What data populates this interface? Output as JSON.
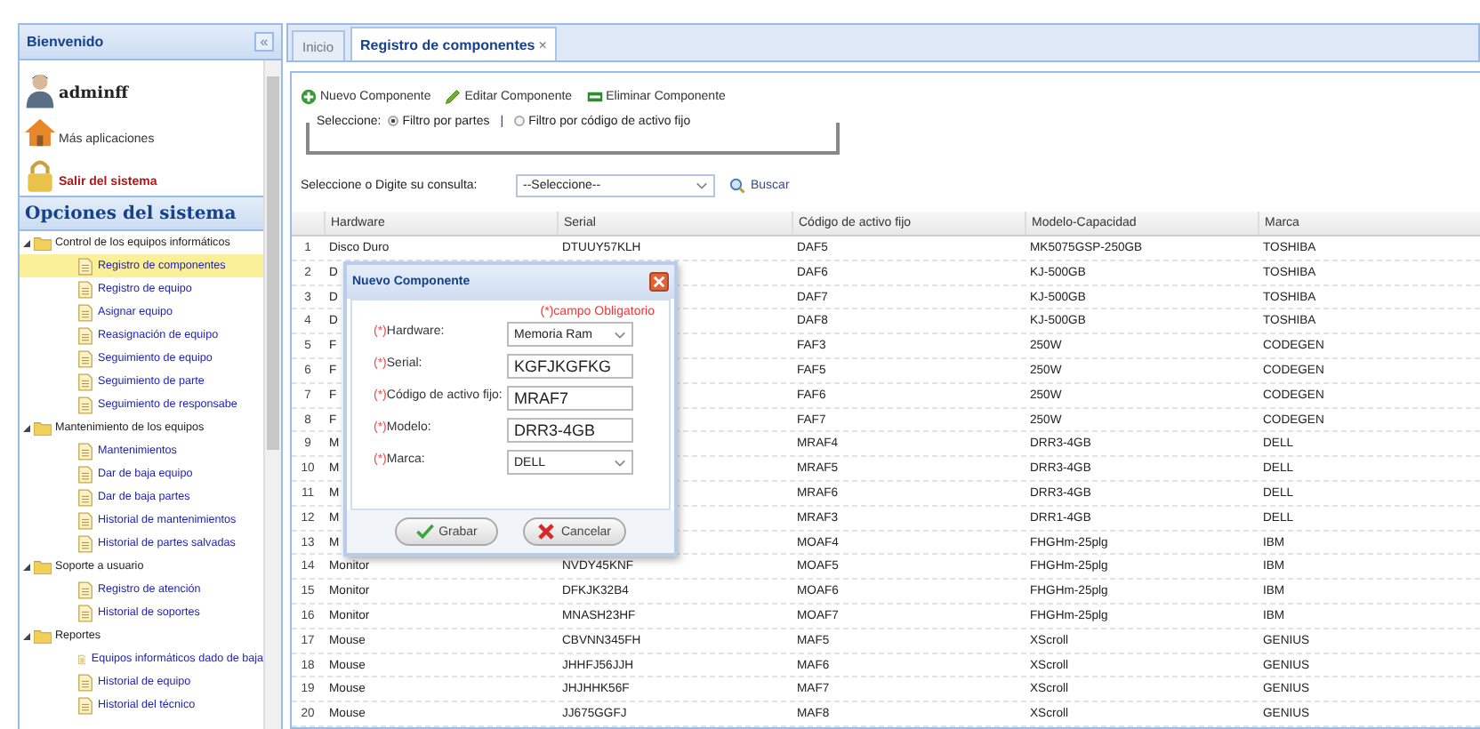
{
  "sidebar": {
    "title": "Bienvenido",
    "collapse": "«",
    "user": "adminff",
    "links": [
      {
        "kind": "apps",
        "label": "Más aplicaciones"
      },
      {
        "kind": "logout",
        "label": "Salir del sistema"
      }
    ],
    "menu_title": "Opciones del sistema",
    "tree": [
      {
        "label": "Control de los equipos informáticos",
        "expanded": true,
        "children": [
          {
            "label": "Registro de componentes",
            "selected": true
          },
          {
            "label": "Registro de equipo",
            "selected": false
          },
          {
            "label": "Asignar equipo",
            "selected": false
          },
          {
            "label": "Reasignación de equipo",
            "selected": false
          },
          {
            "label": "Seguimiento de equipo",
            "selected": false
          },
          {
            "label": "Seguimiento de parte",
            "selected": false
          },
          {
            "label": "Seguimiento de responsabe",
            "selected": false
          }
        ]
      },
      {
        "label": "Mantenimiento de los equipos",
        "expanded": true,
        "children": [
          {
            "label": "Mantenimientos",
            "selected": false
          },
          {
            "label": "Dar de baja equipo",
            "selected": false
          },
          {
            "label": "Dar de baja partes",
            "selected": false
          },
          {
            "label": "Historial de mantenimientos",
            "selected": false
          },
          {
            "label": "Historial de partes salvadas",
            "selected": false
          }
        ]
      },
      {
        "label": "Soporte a usuario",
        "expanded": true,
        "children": [
          {
            "label": "Registro de atención",
            "selected": false
          },
          {
            "label": "Historial de soportes",
            "selected": false
          }
        ]
      },
      {
        "label": "Reportes",
        "expanded": true,
        "children": [
          {
            "label": "Equipos informáticos dado de baja",
            "selected": false
          },
          {
            "label": "Historial de equipo",
            "selected": false
          },
          {
            "label": "Historial del técnico",
            "selected": false
          }
        ]
      }
    ]
  },
  "tabs": [
    {
      "label": "Inicio",
      "selected": false
    },
    {
      "label": "Registro de componentes",
      "selected": true,
      "close": "×"
    }
  ],
  "toolbar": [
    {
      "kind": "add",
      "label": "Nuevo Componente"
    },
    {
      "kind": "edit",
      "label": "Editar Componente"
    },
    {
      "kind": "delete",
      "label": "Eliminar Componente"
    }
  ],
  "filter": {
    "legend": "Seleccione:",
    "separator": "|",
    "options": [
      {
        "label": "Filtro por partes",
        "selected": true
      },
      {
        "label": "Filtro por código de activo fijo",
        "selected": false
      }
    ]
  },
  "search": {
    "label": "Seleccione o Digite su consulta:",
    "value": "--Seleccione--",
    "button": "Buscar"
  },
  "table": {
    "columns": [
      "",
      "Hardware",
      "Serial",
      "Código de activo fijo",
      "Modelo-Capacidad",
      "Marca"
    ],
    "rows": [
      [
        "1",
        "Disco Duro",
        "DTUUY57KLH",
        "DAF5",
        "MK5075GSP-250GB",
        "TOSHIBA"
      ],
      [
        "2",
        "D",
        "",
        "DAF6",
        "KJ-500GB",
        "TOSHIBA"
      ],
      [
        "3",
        "D",
        "",
        "DAF7",
        "KJ-500GB",
        "TOSHIBA"
      ],
      [
        "4",
        "D",
        "",
        "DAF8",
        "KJ-500GB",
        "TOSHIBA"
      ],
      [
        "5",
        "F",
        "",
        "FAF3",
        "250W",
        "CODEGEN"
      ],
      [
        "6",
        "F",
        "",
        "FAF5",
        "250W",
        "CODEGEN"
      ],
      [
        "7",
        "F",
        "",
        "FAF6",
        "250W",
        "CODEGEN"
      ],
      [
        "8",
        "F",
        "",
        "FAF7",
        "250W",
        "CODEGEN"
      ],
      [
        "9",
        "M",
        "",
        "MRAF4",
        "DRR3-4GB",
        "DELL"
      ],
      [
        "10",
        "M",
        "",
        "MRAF5",
        "DRR3-4GB",
        "DELL"
      ],
      [
        "11",
        "M",
        "",
        "MRAF6",
        "DRR3-4GB",
        "DELL"
      ],
      [
        "12",
        "M",
        "",
        "MRAF3",
        "DRR1-4GB",
        "DELL"
      ],
      [
        "13",
        "M",
        "",
        "MOAF4",
        "FHGHm-25plg",
        "IBM"
      ],
      [
        "14",
        "Monitor",
        "NVDY45KNF",
        "MOAF5",
        "FHGHm-25plg",
        "IBM"
      ],
      [
        "15",
        "Monitor",
        "DFKJK32B4",
        "MOAF6",
        "FHGHm-25plg",
        "IBM"
      ],
      [
        "16",
        "Monitor",
        "MNASH23HF",
        "MOAF7",
        "FHGHm-25plg",
        "IBM"
      ],
      [
        "17",
        "Mouse",
        "CBVNN345FH",
        "MAF5",
        "XScroll",
        "GENIUS"
      ],
      [
        "18",
        "Mouse",
        "JHHFJ56JJH",
        "MAF6",
        "XScroll",
        "GENIUS"
      ],
      [
        "19",
        "Mouse",
        "JHJHHK56F",
        "MAF7",
        "XScroll",
        "GENIUS"
      ],
      [
        "20",
        "Mouse",
        "JJ675GGFJ",
        "MAF8",
        "XScroll",
        "GENIUS"
      ]
    ]
  },
  "dialog": {
    "title": "Nuevo Componente",
    "note": "(*)campo Obligatorio",
    "fields": [
      {
        "kind": "select",
        "required": "(*)",
        "label": "Hardware:",
        "value": "Memoria Ram"
      },
      {
        "kind": "input",
        "required": "(*)",
        "label": "Serial:",
        "value": "KGFJKGFKG"
      },
      {
        "kind": "input",
        "required": "(*)",
        "label": "Código de activo fijo:",
        "value": "MRAF7"
      },
      {
        "kind": "input",
        "required": "(*)",
        "label": "Modelo:",
        "value": "DRR3-4GB"
      },
      {
        "kind": "select",
        "required": "(*)",
        "label": "Marca:",
        "value": "DELL"
      }
    ],
    "buttons": [
      {
        "kind": "save",
        "label": "Grabar"
      },
      {
        "kind": "cancel",
        "label": "Cancelar"
      }
    ]
  }
}
